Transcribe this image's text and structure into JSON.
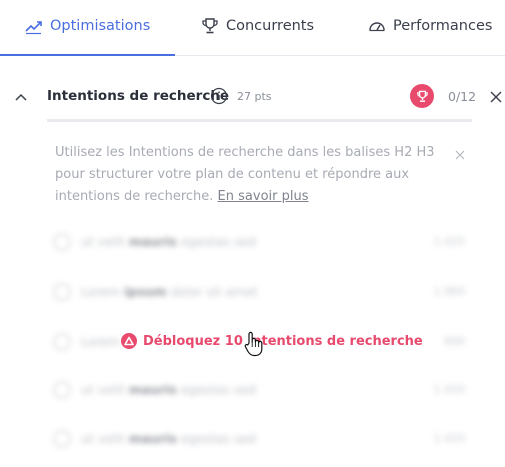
{
  "tabs": [
    {
      "label": "Optimisations",
      "icon": "trending-up-icon",
      "active": true
    },
    {
      "label": "Concurrents",
      "icon": "trophy-icon",
      "active": false
    },
    {
      "label": "Performances",
      "icon": "gauge-icon",
      "active": false
    }
  ],
  "section": {
    "title": "Intentions de recherche",
    "points": "27 pts",
    "progress": "0/12"
  },
  "info": {
    "text": "Utilisez les Intentions de recherche dans les balises H2 H3 pour structurer votre plan de contenu et répondre aux intentions de recherche.",
    "link": "En savoir plus"
  },
  "blurred_rows": [
    {
      "prefix": "ut velit ",
      "bold": "mauris",
      "suffix": " egestas sed",
      "meta": "1.425"
    },
    {
      "prefix": "Lorem ",
      "bold": "ipsum",
      "suffix": " dolor sit amet",
      "meta": "1.984"
    },
    {
      "prefix": "Lorem",
      "bold": "",
      "suffix": "",
      "meta": "890"
    },
    {
      "prefix": "ut velit ",
      "bold": "mauris",
      "suffix": " egestas sed",
      "meta": "1.420"
    },
    {
      "prefix": "ut velit ",
      "bold": "mauris",
      "suffix": " egestas sed",
      "meta": "1.420"
    }
  ],
  "unlock": {
    "label": "Débloquez 10 Intentions de recherche"
  },
  "colors": {
    "accent": "#4a6ee0",
    "brand": "#e84a6e"
  }
}
